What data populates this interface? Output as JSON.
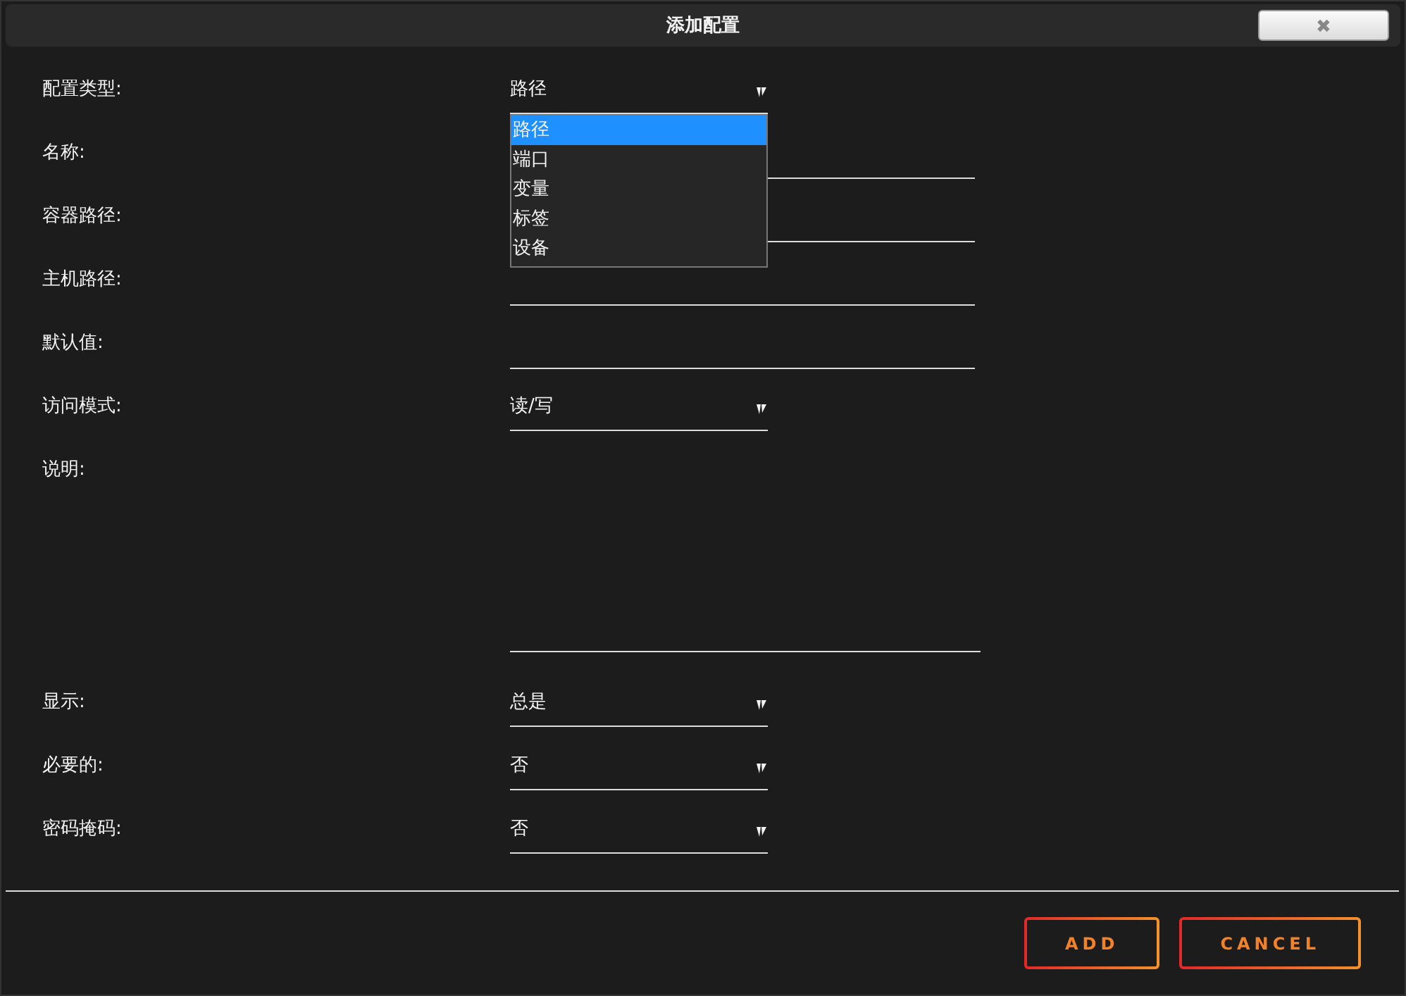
{
  "window": {
    "title": "添加配置",
    "close_label": "✖"
  },
  "fields": [
    {
      "label": "配置类型:",
      "kind": "select",
      "value": "路径",
      "open": true,
      "options": [
        {
          "label": "路径",
          "selected": true
        },
        {
          "label": "端口",
          "selected": false
        },
        {
          "label": "变量",
          "selected": false
        },
        {
          "label": "标签",
          "selected": false
        },
        {
          "label": "设备",
          "selected": false
        }
      ]
    },
    {
      "label": "名称:",
      "kind": "text"
    },
    {
      "label": "容器路径:",
      "kind": "text"
    },
    {
      "label": "主机路径:",
      "kind": "text"
    },
    {
      "label": "默认值:",
      "kind": "text"
    },
    {
      "label": "访问模式:",
      "kind": "select",
      "value": "读/写",
      "open": false
    },
    {
      "label": "说明:",
      "kind": "textarea"
    },
    {
      "label": "显示:",
      "kind": "select",
      "value": "总是",
      "open": false
    },
    {
      "label": "必要的:",
      "kind": "select",
      "value": "否",
      "open": false
    },
    {
      "label": "密码掩码:",
      "kind": "select",
      "value": "否",
      "open": false
    }
  ],
  "buttons": [
    "ADD",
    "CANCEL"
  ]
}
